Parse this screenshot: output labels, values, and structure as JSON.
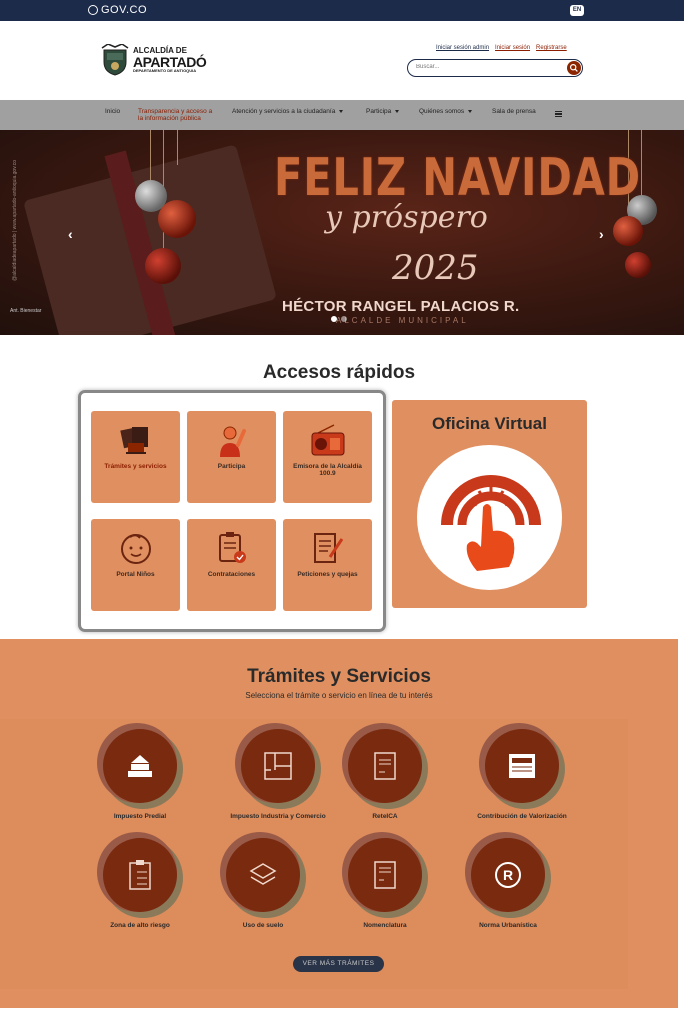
{
  "gov_bar": {
    "logo_text": "GOV.CO",
    "lang_label": "EN"
  },
  "header": {
    "logo": {
      "line1": "ALCALDÍA DE",
      "line2": "APARTADÓ",
      "line3": "DEPARTAMENTO DE ANTIOQUIA"
    },
    "auth_links": [
      "Iniciar sesión admin",
      "Iniciar sesión",
      "Registrarse"
    ],
    "search": {
      "placeholder": "Buscar..."
    }
  },
  "nav": {
    "items": [
      {
        "label": "Inicio",
        "has_caret": false
      },
      {
        "label": "Transparencia y acceso a la información pública",
        "has_caret": false,
        "active": true
      },
      {
        "label": "Atención y servicios a la ciudadanía",
        "has_caret": true
      },
      {
        "label": "Participa",
        "has_caret": true
      },
      {
        "label": "Quiénes somos",
        "has_caret": true
      },
      {
        "label": "Sala de prensa",
        "has_caret": false
      }
    ]
  },
  "hero": {
    "title": "FELIZ NAVIDAD",
    "subtitle": "y próspero",
    "year": "2025",
    "name": "HÉCTOR RANGEL PALACIOS R.",
    "role": "ALCALDE MUNICIPAL",
    "side_text": "@alcaldiadeapartado | www.apartado-antioquia.gov.co",
    "corner_text": "Ant. Bienestar",
    "slides": 2,
    "active_slide": 0
  },
  "quick_access": {
    "title": "Accesos rápidos",
    "tiles": [
      {
        "label": "Trámites y servicios",
        "icon": "documents-icon"
      },
      {
        "label": "Participa",
        "icon": "person-raising-hand-icon"
      },
      {
        "label": "Emisora de la Alcaldía 100.9",
        "icon": "radio-icon"
      },
      {
        "label": "Portal Niños",
        "icon": "child-face-icon"
      },
      {
        "label": "Contrataciones",
        "icon": "clipboard-check-icon"
      },
      {
        "label": "Peticiones y quejas",
        "icon": "document-pen-icon"
      }
    ],
    "virtual_office": {
      "title": "Oficina Virtual",
      "icon": "touch-hand-icon"
    }
  },
  "tramites": {
    "title": "Trámites y Servicios",
    "subtitle": "Selecciona el trámite o servicio en línea de tu interés",
    "items": [
      {
        "label": "Impuesto Predial",
        "icon": "house-cash-icon"
      },
      {
        "label": "Impuesto Industria y Comercio",
        "icon": "floor-plan-icon"
      },
      {
        "label": "ReteICA",
        "icon": "receipt-icon"
      },
      {
        "label": "Contribución de Valorización",
        "icon": "newspaper-icon"
      },
      {
        "label": "Zona de alto riesgo",
        "icon": "checklist-icon"
      },
      {
        "label": "Uso de suelo",
        "icon": "layers-icon"
      },
      {
        "label": "Nomenclatura",
        "icon": "invoice-icon"
      },
      {
        "label": "Norma Urbanística",
        "icon": "registered-icon"
      }
    ],
    "more_button": "VER MÁS TRÁMITES"
  },
  "colors": {
    "navy": "#1c2b4a",
    "accent": "#8b1d00",
    "tile": "#e09060",
    "icon_fill": "#7a2a0e"
  }
}
